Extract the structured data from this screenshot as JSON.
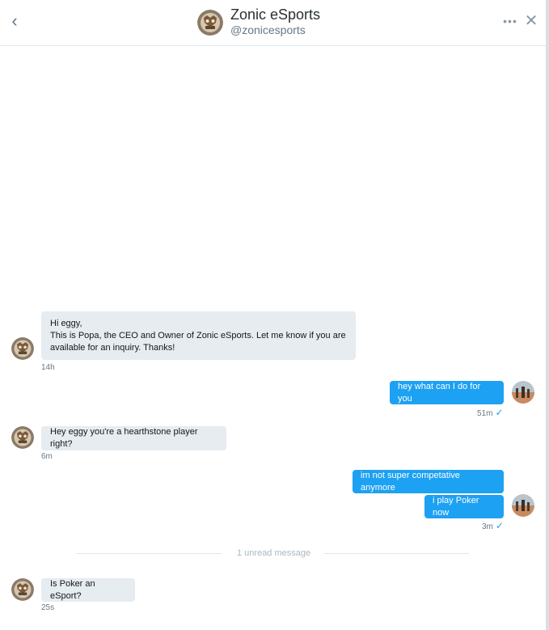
{
  "header": {
    "back_icon": "chevron-left-icon",
    "name": "Zonic eSports",
    "handle": "@zonicesports",
    "more_icon": "more-dots-icon",
    "close_icon": "close-icon"
  },
  "colors": {
    "accent": "#1da1f2",
    "incoming_bubble": "#e6ecf0",
    "muted_text": "#657786"
  },
  "messages": [
    {
      "direction": "incoming",
      "lines": [
        "Hi eggy,",
        "This is Popa, the CEO and Owner of Zonic eSports.  Let me know if you are",
        "available for an inquiry.  Thanks!"
      ],
      "time": "14h"
    },
    {
      "direction": "outgoing",
      "text": "hey what can I do for you",
      "time": "51m",
      "read_icon": "checkmark-icon"
    },
    {
      "direction": "incoming",
      "text": "Hey eggy you're a hearthstone player right?",
      "time": "6m"
    },
    {
      "direction": "outgoing",
      "text": "im not super competative  anymore"
    },
    {
      "direction": "outgoing",
      "text": "i play Poker now",
      "time": "3m",
      "read_icon": "checkmark-icon"
    },
    {
      "direction": "incoming",
      "text": "Is Poker an eSport?",
      "time": "25s"
    }
  ],
  "unread_divider": "1 unread message"
}
